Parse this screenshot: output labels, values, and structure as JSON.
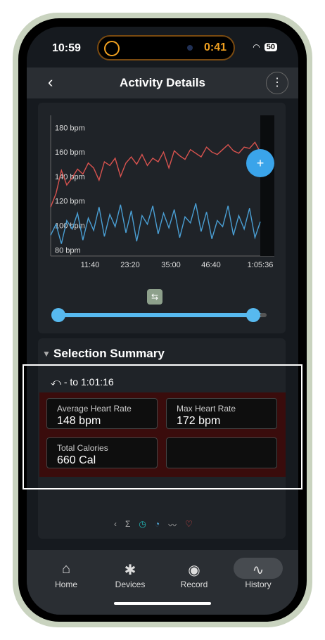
{
  "status": {
    "time": "10:59",
    "timer": "0:41",
    "battery": "50"
  },
  "appbar": {
    "title": "Activity Details"
  },
  "chart_data": {
    "type": "line",
    "title": "",
    "xlabel": "",
    "ylabel": "",
    "x_ticks": [
      "11:40",
      "23:20",
      "35:00",
      "46:40",
      "1:05:36"
    ],
    "y_ticks": [
      "180 bpm",
      "160 bpm",
      "140 bpm",
      "120 bpm",
      "100 bpm",
      "80 bpm"
    ],
    "ylim": [
      75,
      190
    ],
    "series": [
      {
        "color": "#d9534f",
        "values": [
          115,
          126,
          145,
          133,
          139,
          146,
          142,
          151,
          147,
          137,
          152,
          149,
          155,
          140,
          151,
          156,
          150,
          158,
          149,
          155,
          152,
          160,
          147,
          161,
          157,
          154,
          162,
          159,
          156,
          164,
          160,
          158,
          162,
          166,
          161,
          159,
          164,
          163,
          168,
          160
        ]
      },
      {
        "color": "#4a9fd4",
        "values": [
          92,
          101,
          85,
          104,
          97,
          110,
          88,
          106,
          96,
          115,
          91,
          109,
          99,
          117,
          94,
          112,
          87,
          108,
          101,
          116,
          93,
          110,
          98,
          113,
          90,
          107,
          102,
          118,
          95,
          111,
          89,
          104,
          99,
          116,
          92,
          108,
          97,
          114,
          90,
          103
        ]
      }
    ],
    "colors": {
      "heart": "#d9534f",
      "cadence": "#4a9fd4",
      "fab": "#3aa4ea",
      "slider": "#57b9ef"
    }
  },
  "summary": {
    "title": "Selection Summary",
    "range": "- to 1:01:16",
    "metrics": [
      {
        "label": "Average Heart Rate",
        "value": "148 bpm"
      },
      {
        "label": "Max Heart Rate",
        "value": "172 bpm"
      },
      {
        "label": "Total Calories",
        "value": "660 Cal"
      }
    ]
  },
  "tabs": [
    {
      "label": "Home"
    },
    {
      "label": "Devices"
    },
    {
      "label": "Record"
    },
    {
      "label": "History"
    }
  ]
}
